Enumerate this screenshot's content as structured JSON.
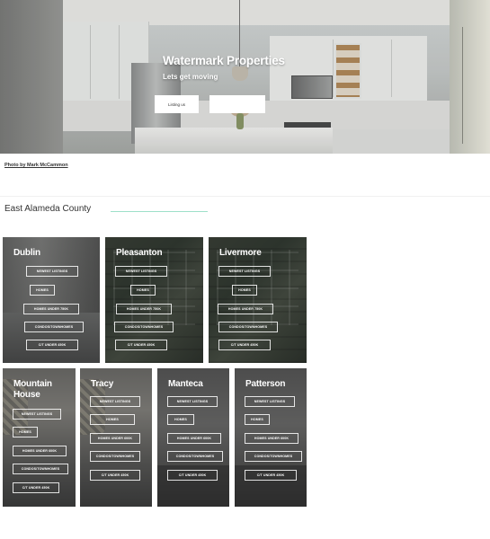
{
  "hero": {
    "title": "Watermark Properties",
    "subtitle": "Lets get moving",
    "button_primary": "Listing us",
    "button_secondary": ""
  },
  "photo_credit": "Photo by Mark McCammon",
  "section": {
    "title": "East Alameda County",
    "accent_color": "#9ee0c9"
  },
  "cities": [
    {
      "name": "Dublin",
      "links": [
        "NEWEST LISTINGS",
        "HOMES",
        "HOMES UNDER 750K",
        "CONDOS/TOWNHOMES",
        "C/T UNDER 450K"
      ]
    },
    {
      "name": "Pleasanton",
      "links": [
        "NEWEST LISTINGS",
        "HOMES",
        "HOMES UNDER 750K",
        "CONDOS/TOWNHOMES",
        "C/T UNDER 450K"
      ]
    },
    {
      "name": "Livermore",
      "links": [
        "NEWEST LISTINGS",
        "HOMES",
        "HOMES UNDER 750K",
        "CONDOS/TOWNHOMES",
        "C/T UNDER 450K"
      ]
    },
    {
      "name": "Mountain House",
      "links": [
        "NEWEST LISTINGS",
        "HOMES",
        "HOMES UNDER 600K",
        "CONDOS/TOWNHOMES",
        "C/T UNDER 450K"
      ]
    },
    {
      "name": "Tracy",
      "links": [
        "NEWEST LISTINGS",
        "HOMES",
        "HOMES UNDER 600K",
        "CONDOS/TOWNHOMES",
        "C/T UNDER 450K"
      ]
    },
    {
      "name": "Manteca",
      "links": [
        "NEWEST LISTINGS",
        "HOMES",
        "HOMES UNDER 600K",
        "CONDOS/TOWNHOMES",
        "C/T UNDER 450K"
      ]
    },
    {
      "name": "Patterson",
      "links": [
        "NEWEST LISTINGS",
        "HOMES",
        "HOMES UNDER 600K",
        "CONDOS/TOWNHOMES",
        "C/T UNDER 450K"
      ]
    }
  ]
}
